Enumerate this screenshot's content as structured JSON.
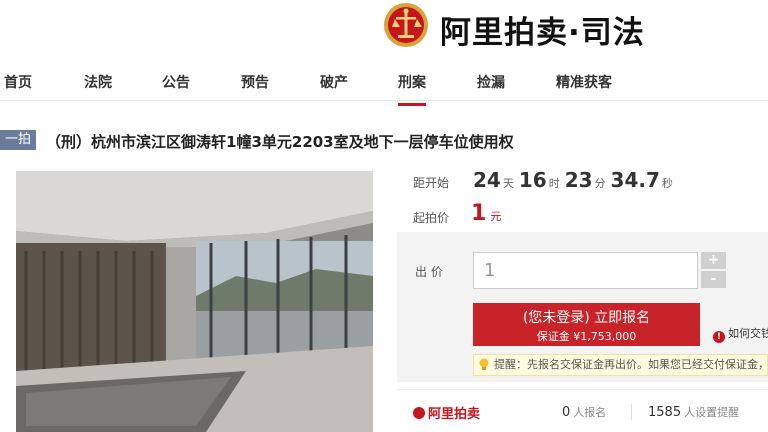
{
  "brand": {
    "title": "阿里拍卖·司法",
    "emblem_icon": "court-emblem-icon",
    "accent": "#c4161c"
  },
  "nav": {
    "items": [
      "首页",
      "法院",
      "公告",
      "预告",
      "破产",
      "刑案",
      "捡漏",
      "精准获客"
    ],
    "active": "刑案"
  },
  "lot": {
    "tag": "一拍",
    "title": "（刑）杭州市滨江区御涛轩1幢3单元2203室及地下一层停车位使用权",
    "photo_icon": "apartment-interior-photo"
  },
  "countdown": {
    "label": "距开始",
    "days": "24",
    "days_unit": "天",
    "hours": "16",
    "hours_unit": "时",
    "minutes": "23",
    "minutes_unit": "分",
    "seconds": "34.7",
    "seconds_unit": "秒"
  },
  "start_price": {
    "label": "起拍价",
    "value": "1",
    "unit": "元"
  },
  "bid": {
    "label": "出 价",
    "input_placeholder": "1",
    "plus": "+",
    "minus": "-",
    "signup_line1": "(您未登录) 立即报名",
    "signup_line2": "保证金 ¥1,753,000",
    "howto": "如何交钱",
    "reminder": "提醒：先报名交保证金再出价。如果您已经交付保证金，"
  },
  "stats": {
    "logo": "阿里拍卖",
    "signups_count": "0",
    "signups_label": "人报名",
    "reminders_count": "1585",
    "reminders_label": "人设置提醒"
  }
}
